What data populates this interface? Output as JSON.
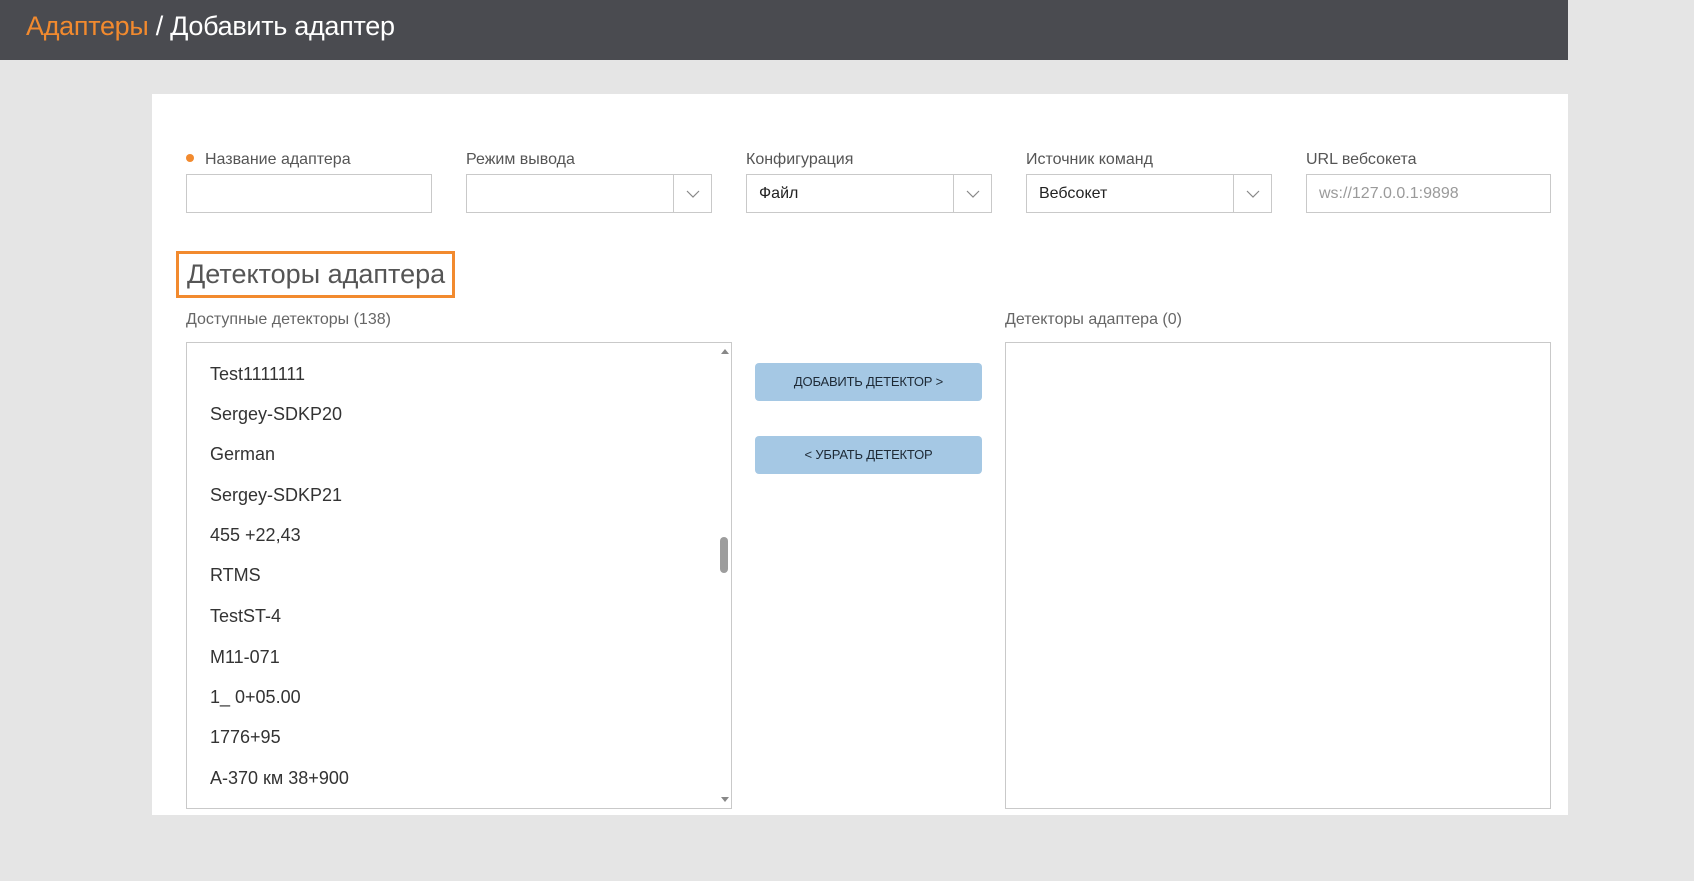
{
  "header": {
    "breadcrumb_link": "Адаптеры",
    "breadcrumb_separator": " / ",
    "breadcrumb_current": "Добавить адаптер"
  },
  "form": {
    "adapter_name": {
      "label": "Название адаптера",
      "value": "",
      "required": true
    },
    "output_mode": {
      "label": "Режим вывода",
      "value": ""
    },
    "configuration": {
      "label": "Конфигурация",
      "value": "Файл"
    },
    "command_source": {
      "label": "Источник команд",
      "value": "Вебсокет"
    },
    "websocket_url": {
      "label": "URL вебсокета",
      "value": "",
      "placeholder": "ws://127.0.0.1:9898"
    }
  },
  "detectors": {
    "section_title": "Детекторы адаптера",
    "available_label": "Доступные детекторы (138)",
    "assigned_label": "Детекторы адаптера (0)",
    "available_items": [
      "Test1111111",
      "Sergey-SDKP20",
      "German",
      "Sergey-SDKP21",
      "455 +22,43",
      "RTMS",
      "TestST-4",
      "M11-071",
      "1_ 0+05.00",
      "1776+95",
      "А-370 км 38+900"
    ],
    "add_button": "ДОБАВИТЬ ДЕТЕКТОР >",
    "remove_button": "< УБРАТЬ ДЕТЕКТОР"
  },
  "colors": {
    "accent": "#f28a2e",
    "header_bg": "#4a4b50",
    "button_bg": "#a5c8e4"
  },
  "icons": {
    "select_arrow": "chevron-down-icon",
    "scroll_up": "scroll-up-arrow-icon",
    "scroll_down": "scroll-down-arrow-icon"
  }
}
